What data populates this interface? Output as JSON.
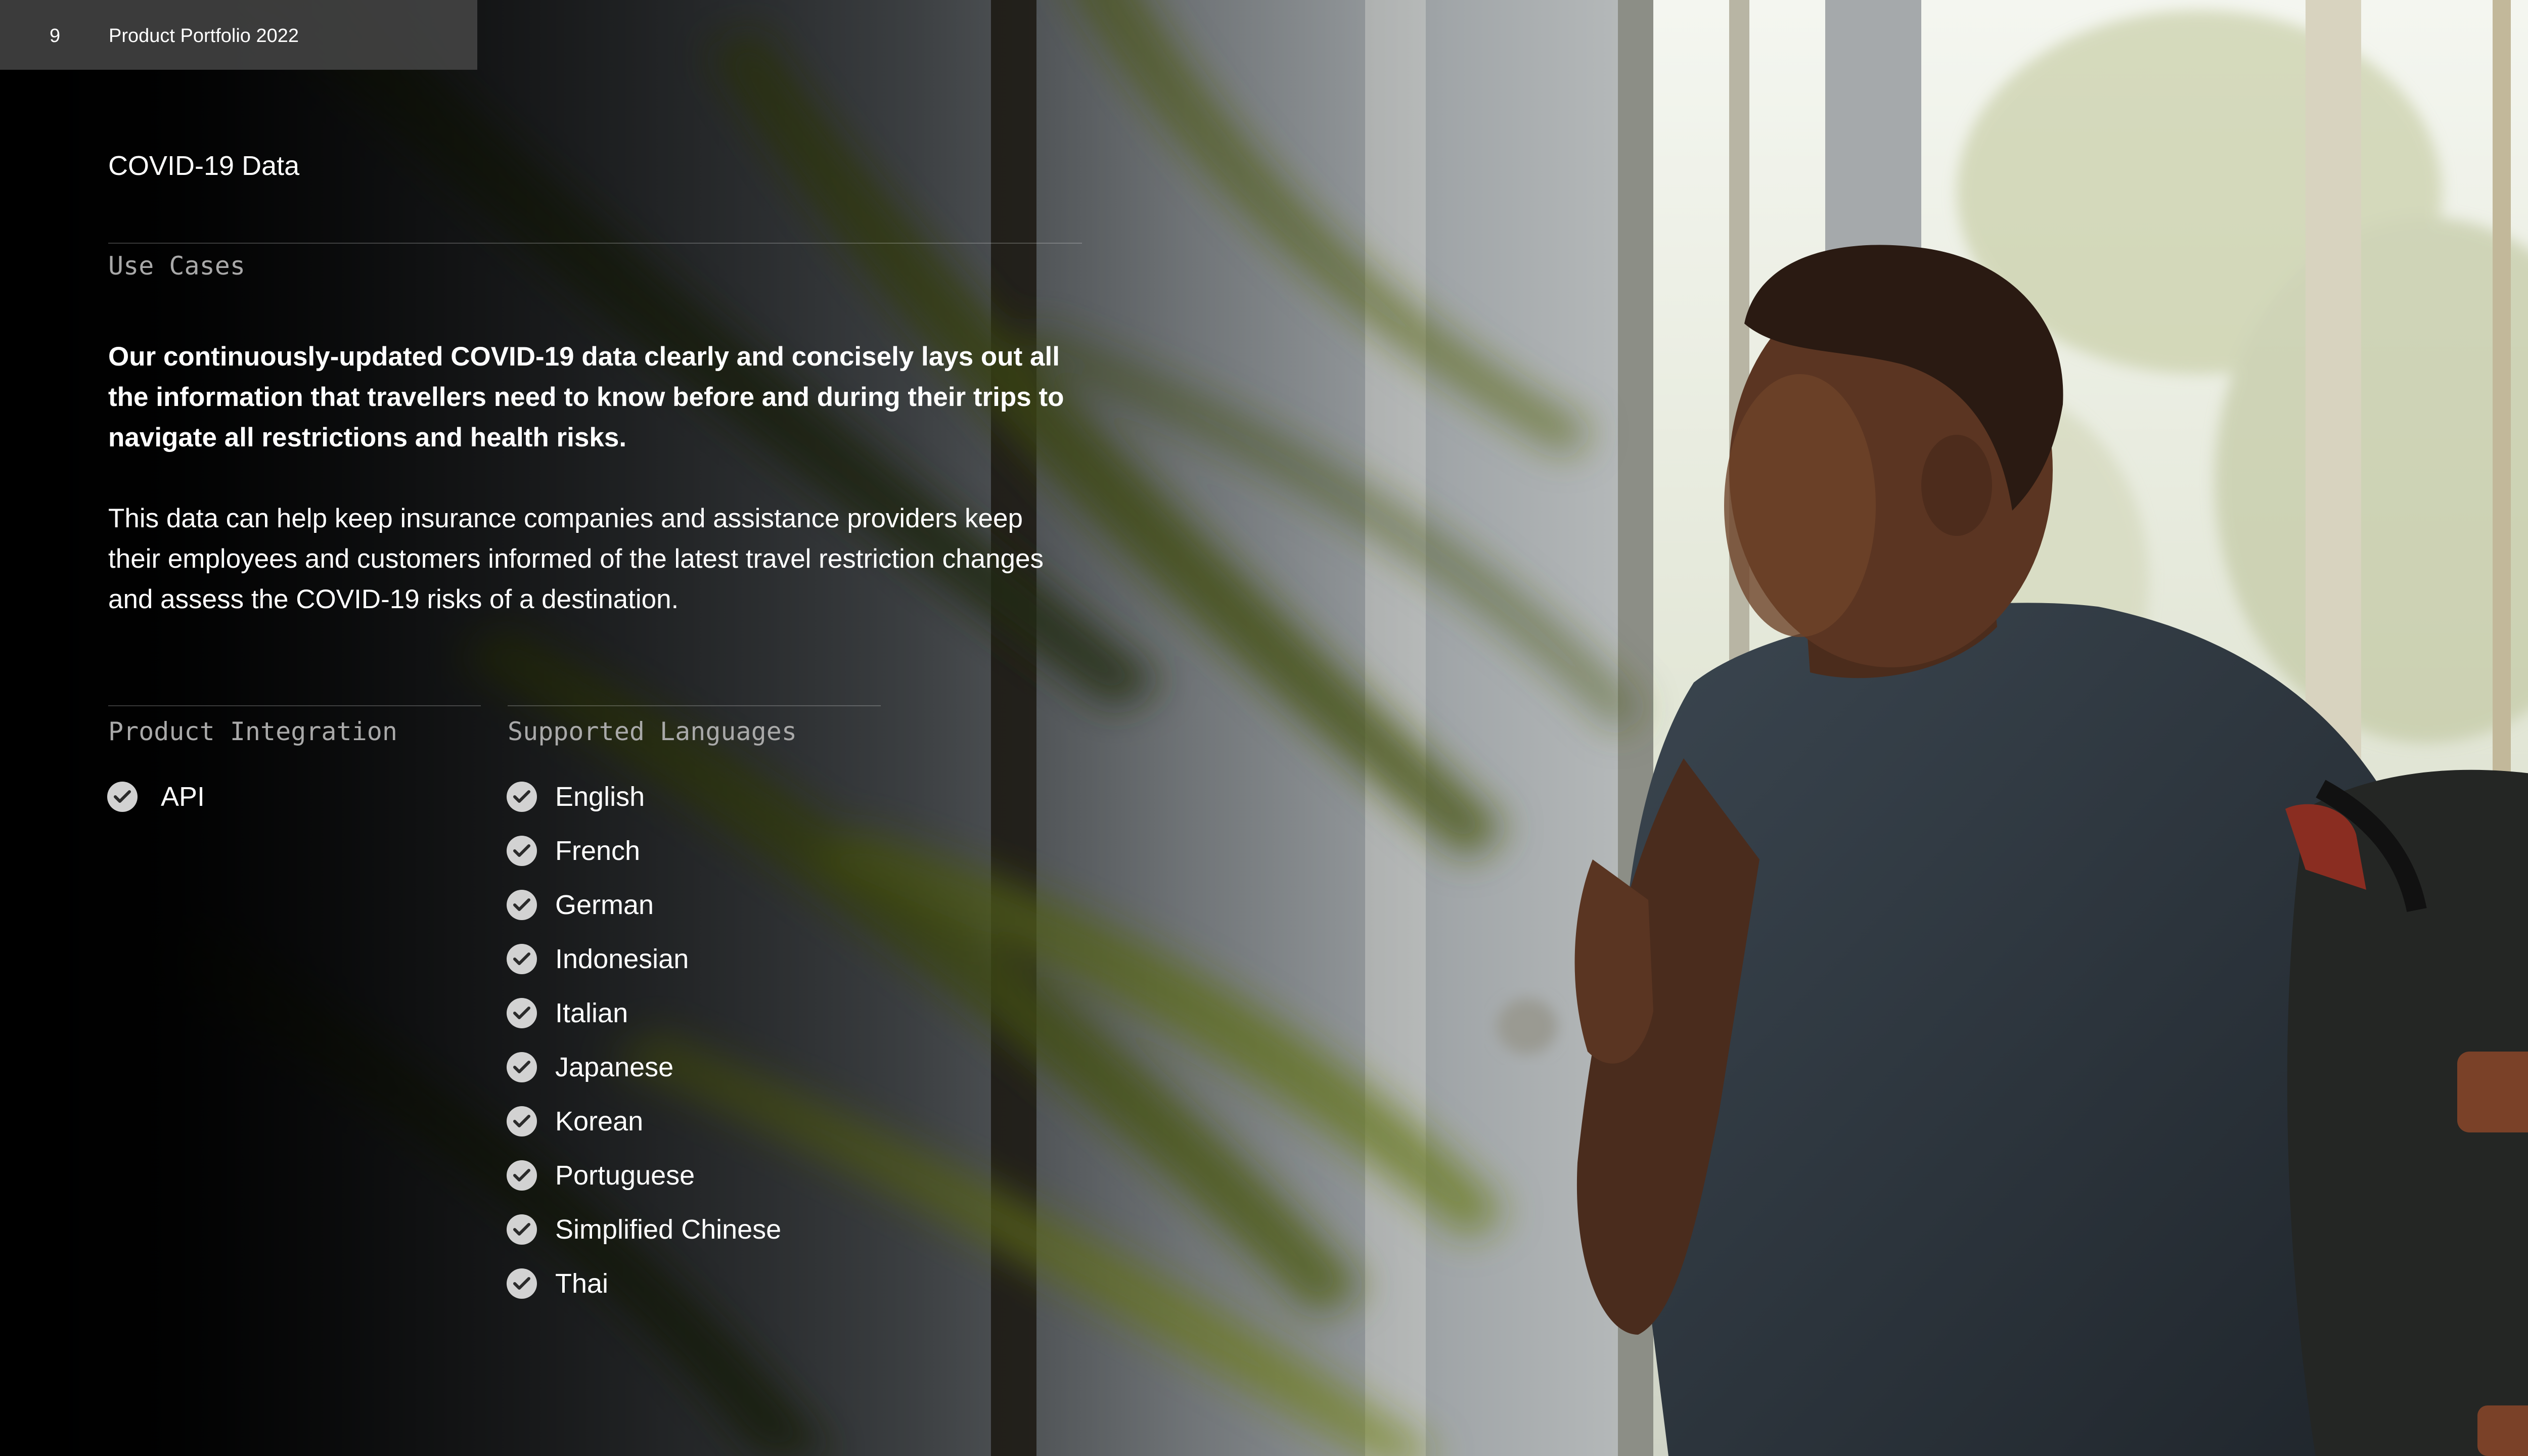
{
  "header": {
    "page_number": "9",
    "title": "Product Portfolio 2022"
  },
  "section_title": "COVID-19 Data",
  "use_cases": {
    "label": "Use Cases",
    "lead": "Our continuously-updated COVID-19 data clearly and concisely lays out all the information that travellers need to know before and during their trips to navigate all restrictions and health risks.",
    "body": "This data can help keep insurance companies and assistance providers keep their employees and customers informed of the latest travel restriction changes and assess the COVID-19 risks of a destination."
  },
  "product_integration": {
    "label": "Product Integration",
    "items": [
      "API"
    ]
  },
  "supported_languages": {
    "label": "Supported Languages",
    "items": [
      "English",
      "French",
      "German",
      "Indonesian",
      "Italian",
      "Japanese",
      "Korean",
      "Portuguese",
      "Simplified Chinese",
      "Thai"
    ]
  },
  "icons": {
    "list_item": "check-circle-icon"
  },
  "colors": {
    "text": "#ffffff",
    "label": "#a9a9a9",
    "check_fill": "#d2d2d2",
    "check_mark": "#2a2a2a",
    "header_bar": "#484848"
  }
}
